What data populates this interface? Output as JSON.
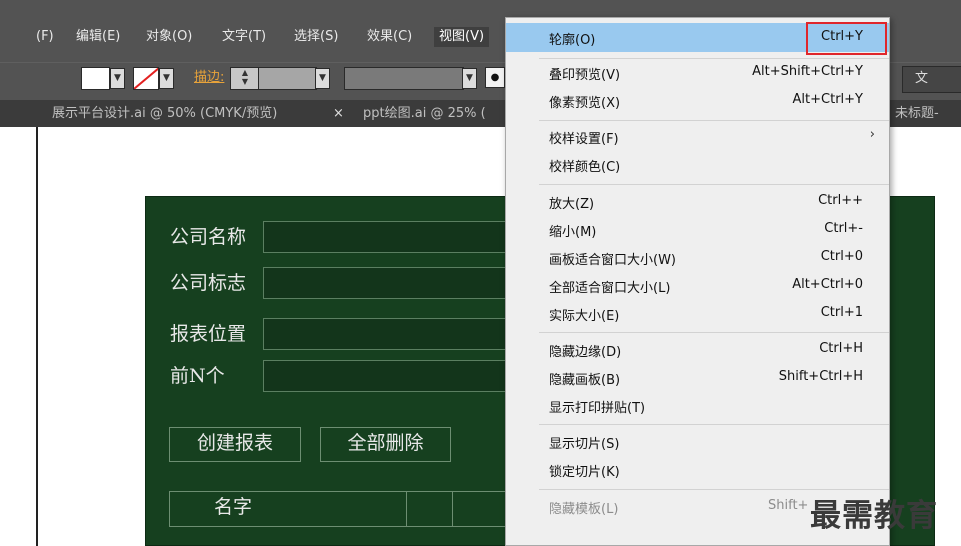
{
  "menubar": {
    "items": [
      "(F)",
      "编辑(E)",
      "对象(O)",
      "文字(T)",
      "选择(S)",
      "效果(C)",
      "视图(V)"
    ],
    "active_index": 6
  },
  "toolbar": {
    "stroke_label": "描边:",
    "right_button_label": "文"
  },
  "doc_tabs": {
    "tab1": "展示平台设计.ai @ 50% (CMYK/预览)",
    "tab1_close": "×",
    "tab2": "ppt绘图.ai @ 25% (",
    "tab3_partial": "未标题-"
  },
  "form": {
    "company_name_label": "公司名称",
    "company_logo_label": "公司标志",
    "report_position_label": "报表位置",
    "top_n_label": "前N个",
    "create_button": "创建报表",
    "delete_all_button": "全部删除",
    "table_header_name": "名字"
  },
  "view_menu": {
    "items": [
      {
        "label": "轮廓(O)",
        "shortcut": "Ctrl+Y"
      },
      {
        "label": "叠印预览(V)",
        "shortcut": "Alt+Shift+Ctrl+Y"
      },
      {
        "label": "像素预览(X)",
        "shortcut": "Alt+Ctrl+Y"
      },
      {
        "label": "校样设置(F)",
        "shortcut": "›"
      },
      {
        "label": "校样颜色(C)",
        "shortcut": ""
      },
      {
        "label": "放大(Z)",
        "shortcut": "Ctrl++"
      },
      {
        "label": "缩小(M)",
        "shortcut": "Ctrl+-"
      },
      {
        "label": "画板适合窗口大小(W)",
        "shortcut": "Ctrl+0"
      },
      {
        "label": "全部适合窗口大小(L)",
        "shortcut": "Alt+Ctrl+0"
      },
      {
        "label": "实际大小(E)",
        "shortcut": "Ctrl+1"
      },
      {
        "label": "隐藏边缘(D)",
        "shortcut": "Ctrl+H"
      },
      {
        "label": "隐藏画板(B)",
        "shortcut": "Shift+Ctrl+H"
      },
      {
        "label": "显示打印拼贴(T)",
        "shortcut": ""
      },
      {
        "label": "显示切片(S)",
        "shortcut": ""
      },
      {
        "label": "锁定切片(K)",
        "shortcut": ""
      },
      {
        "label": "隐藏模板(L)",
        "shortcut": "Shift+"
      }
    ]
  },
  "watermark": "最需教育",
  "colors": {
    "highlight": "#99c9ef",
    "annotation_box": "#e0262b",
    "panel_green": "#16401f"
  }
}
